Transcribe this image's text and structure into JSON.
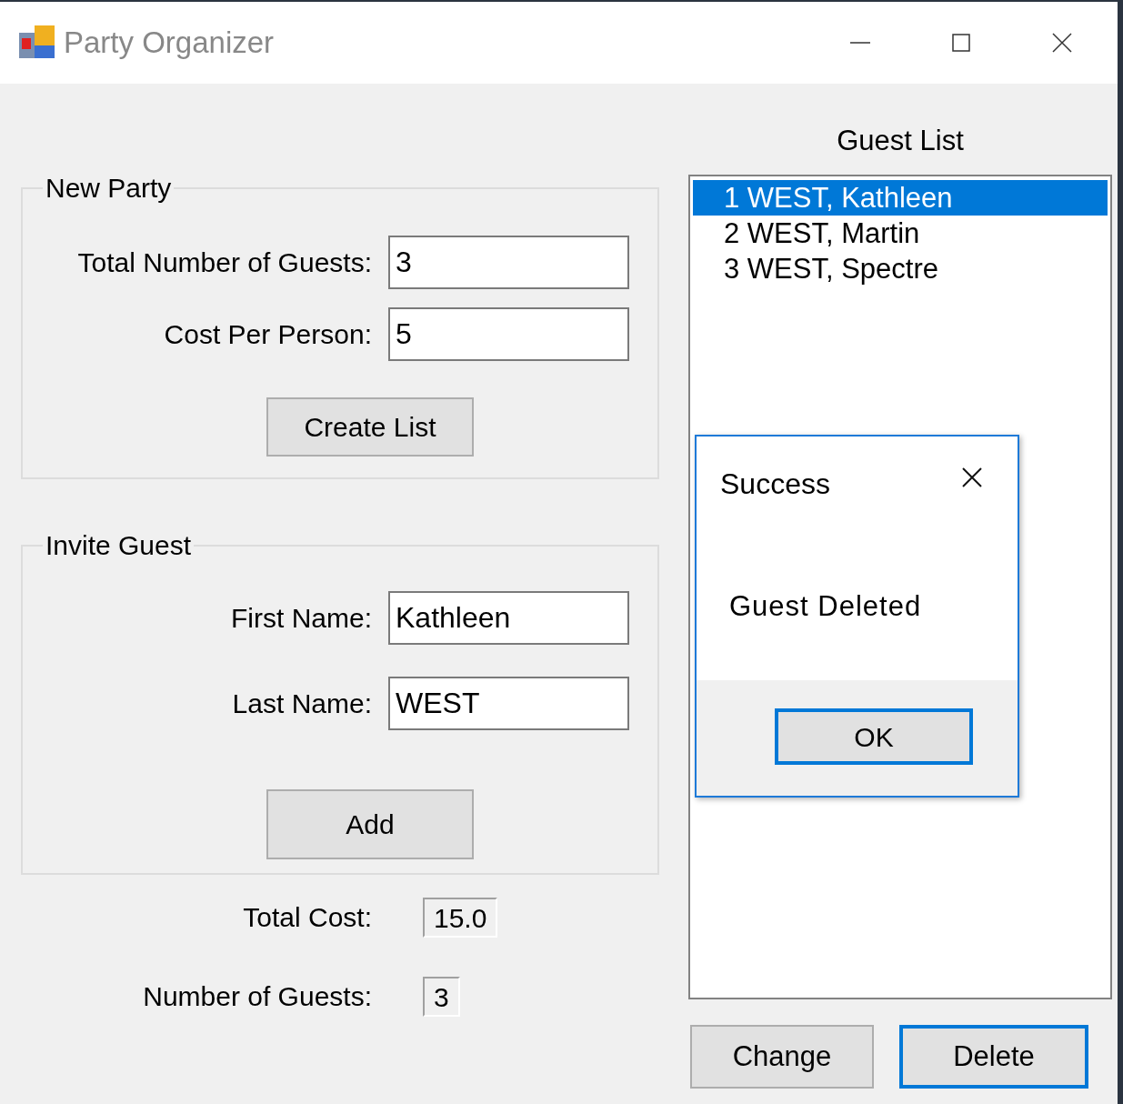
{
  "window": {
    "title": "Party Organizer"
  },
  "new_party": {
    "title": "New Party",
    "fields": [
      {
        "label": "Total Number of Guests:",
        "value": "3"
      },
      {
        "label": "Cost Per Person:",
        "value": "5"
      }
    ],
    "button": "Create List"
  },
  "invite_guest": {
    "title": "Invite Guest",
    "fields": [
      {
        "label": "First Name:",
        "value": "Kathleen"
      },
      {
        "label": "Last Name:",
        "value": "WEST"
      }
    ],
    "button": "Add"
  },
  "totals": [
    {
      "label": "Total Cost:",
      "value": "15.0"
    },
    {
      "label": "Number of Guests:",
      "value": "3"
    }
  ],
  "guest_list": {
    "title": "Guest List",
    "items": [
      {
        "text": "1 WEST, Kathleen",
        "selected": true
      },
      {
        "text": "2 WEST, Martin",
        "selected": false
      },
      {
        "text": "3 WEST, Spectre",
        "selected": false
      }
    ]
  },
  "buttons": [
    {
      "label": "Change",
      "focused": false
    },
    {
      "label": "Delete",
      "focused": true
    }
  ],
  "dialog": {
    "title": "Success",
    "message": "Guest Deleted",
    "button": "OK"
  }
}
